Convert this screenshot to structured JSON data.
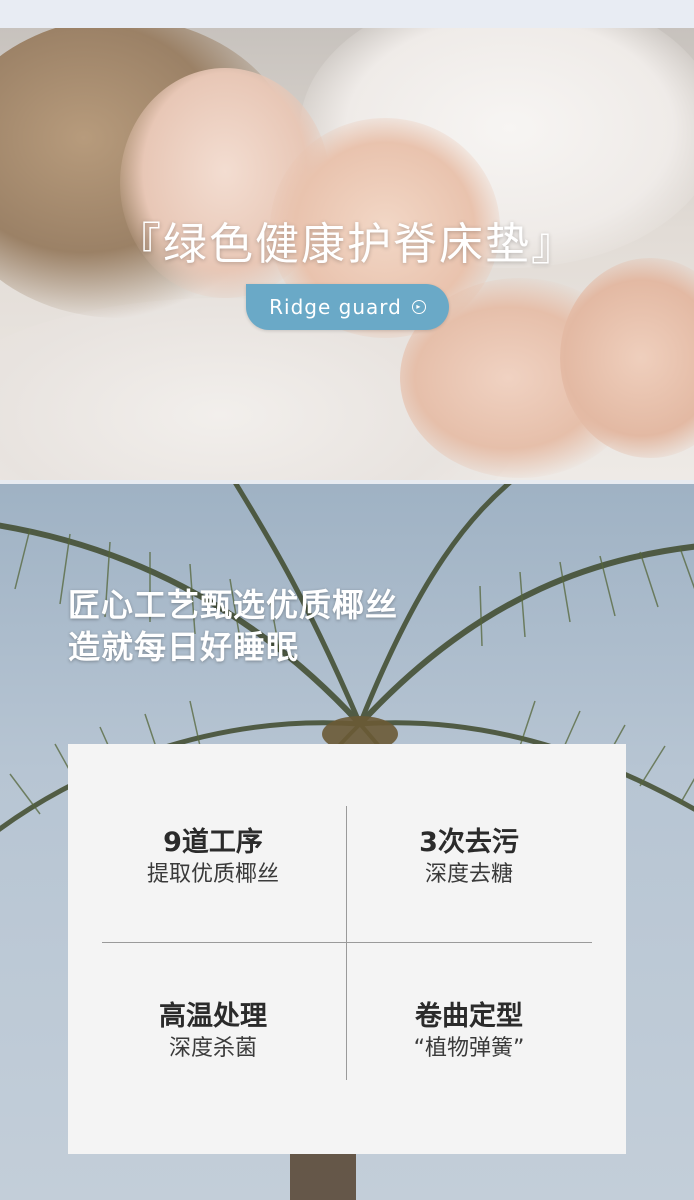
{
  "hero": {
    "title": "『绿色健康护脊床垫』",
    "cta_label": "Ridge guard",
    "cta_icon": "arrow-circle-icon"
  },
  "section": {
    "heading_line1": "匠心工艺甄选优质椰丝",
    "heading_line2": "造就每日好睡眠"
  },
  "features": [
    {
      "title": "9道工序",
      "subtitle": "提取优质椰丝"
    },
    {
      "title": "3次去污",
      "subtitle": "深度去糖"
    },
    {
      "title": "高温处理",
      "subtitle": "深度杀菌"
    },
    {
      "title": "卷曲定型",
      "subtitle": "“植物弹簧”"
    }
  ],
  "colors": {
    "cta_bg": "#6aa9c7",
    "card_bg": "#f4f4f4",
    "divider": "#9a9a9a"
  }
}
